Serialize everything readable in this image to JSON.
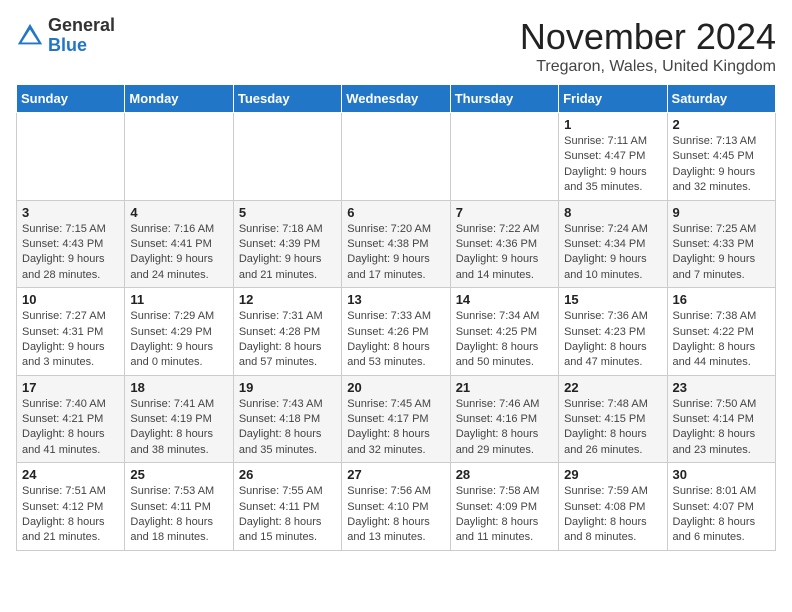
{
  "logo": {
    "general": "General",
    "blue": "Blue"
  },
  "header": {
    "month": "November 2024",
    "location": "Tregaron, Wales, United Kingdom"
  },
  "weekdays": [
    "Sunday",
    "Monday",
    "Tuesday",
    "Wednesday",
    "Thursday",
    "Friday",
    "Saturday"
  ],
  "weeks": [
    [
      {
        "day": "",
        "info": ""
      },
      {
        "day": "",
        "info": ""
      },
      {
        "day": "",
        "info": ""
      },
      {
        "day": "",
        "info": ""
      },
      {
        "day": "",
        "info": ""
      },
      {
        "day": "1",
        "info": "Sunrise: 7:11 AM\nSunset: 4:47 PM\nDaylight: 9 hours and 35 minutes."
      },
      {
        "day": "2",
        "info": "Sunrise: 7:13 AM\nSunset: 4:45 PM\nDaylight: 9 hours and 32 minutes."
      }
    ],
    [
      {
        "day": "3",
        "info": "Sunrise: 7:15 AM\nSunset: 4:43 PM\nDaylight: 9 hours and 28 minutes."
      },
      {
        "day": "4",
        "info": "Sunrise: 7:16 AM\nSunset: 4:41 PM\nDaylight: 9 hours and 24 minutes."
      },
      {
        "day": "5",
        "info": "Sunrise: 7:18 AM\nSunset: 4:39 PM\nDaylight: 9 hours and 21 minutes."
      },
      {
        "day": "6",
        "info": "Sunrise: 7:20 AM\nSunset: 4:38 PM\nDaylight: 9 hours and 17 minutes."
      },
      {
        "day": "7",
        "info": "Sunrise: 7:22 AM\nSunset: 4:36 PM\nDaylight: 9 hours and 14 minutes."
      },
      {
        "day": "8",
        "info": "Sunrise: 7:24 AM\nSunset: 4:34 PM\nDaylight: 9 hours and 10 minutes."
      },
      {
        "day": "9",
        "info": "Sunrise: 7:25 AM\nSunset: 4:33 PM\nDaylight: 9 hours and 7 minutes."
      }
    ],
    [
      {
        "day": "10",
        "info": "Sunrise: 7:27 AM\nSunset: 4:31 PM\nDaylight: 9 hours and 3 minutes."
      },
      {
        "day": "11",
        "info": "Sunrise: 7:29 AM\nSunset: 4:29 PM\nDaylight: 9 hours and 0 minutes."
      },
      {
        "day": "12",
        "info": "Sunrise: 7:31 AM\nSunset: 4:28 PM\nDaylight: 8 hours and 57 minutes."
      },
      {
        "day": "13",
        "info": "Sunrise: 7:33 AM\nSunset: 4:26 PM\nDaylight: 8 hours and 53 minutes."
      },
      {
        "day": "14",
        "info": "Sunrise: 7:34 AM\nSunset: 4:25 PM\nDaylight: 8 hours and 50 minutes."
      },
      {
        "day": "15",
        "info": "Sunrise: 7:36 AM\nSunset: 4:23 PM\nDaylight: 8 hours and 47 minutes."
      },
      {
        "day": "16",
        "info": "Sunrise: 7:38 AM\nSunset: 4:22 PM\nDaylight: 8 hours and 44 minutes."
      }
    ],
    [
      {
        "day": "17",
        "info": "Sunrise: 7:40 AM\nSunset: 4:21 PM\nDaylight: 8 hours and 41 minutes."
      },
      {
        "day": "18",
        "info": "Sunrise: 7:41 AM\nSunset: 4:19 PM\nDaylight: 8 hours and 38 minutes."
      },
      {
        "day": "19",
        "info": "Sunrise: 7:43 AM\nSunset: 4:18 PM\nDaylight: 8 hours and 35 minutes."
      },
      {
        "day": "20",
        "info": "Sunrise: 7:45 AM\nSunset: 4:17 PM\nDaylight: 8 hours and 32 minutes."
      },
      {
        "day": "21",
        "info": "Sunrise: 7:46 AM\nSunset: 4:16 PM\nDaylight: 8 hours and 29 minutes."
      },
      {
        "day": "22",
        "info": "Sunrise: 7:48 AM\nSunset: 4:15 PM\nDaylight: 8 hours and 26 minutes."
      },
      {
        "day": "23",
        "info": "Sunrise: 7:50 AM\nSunset: 4:14 PM\nDaylight: 8 hours and 23 minutes."
      }
    ],
    [
      {
        "day": "24",
        "info": "Sunrise: 7:51 AM\nSunset: 4:12 PM\nDaylight: 8 hours and 21 minutes."
      },
      {
        "day": "25",
        "info": "Sunrise: 7:53 AM\nSunset: 4:11 PM\nDaylight: 8 hours and 18 minutes."
      },
      {
        "day": "26",
        "info": "Sunrise: 7:55 AM\nSunset: 4:11 PM\nDaylight: 8 hours and 15 minutes."
      },
      {
        "day": "27",
        "info": "Sunrise: 7:56 AM\nSunset: 4:10 PM\nDaylight: 8 hours and 13 minutes."
      },
      {
        "day": "28",
        "info": "Sunrise: 7:58 AM\nSunset: 4:09 PM\nDaylight: 8 hours and 11 minutes."
      },
      {
        "day": "29",
        "info": "Sunrise: 7:59 AM\nSunset: 4:08 PM\nDaylight: 8 hours and 8 minutes."
      },
      {
        "day": "30",
        "info": "Sunrise: 8:01 AM\nSunset: 4:07 PM\nDaylight: 8 hours and 6 minutes."
      }
    ]
  ]
}
